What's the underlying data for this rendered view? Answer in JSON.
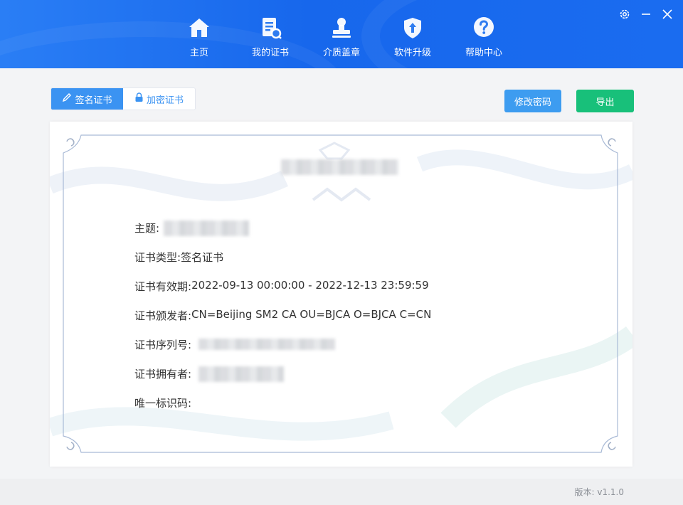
{
  "nav": {
    "items": [
      {
        "label": "主页",
        "icon": "home-icon"
      },
      {
        "label": "我的证书",
        "icon": "certificate-icon"
      },
      {
        "label": "介质盖章",
        "icon": "stamp-icon"
      },
      {
        "label": "软件升级",
        "icon": "upgrade-shield-icon"
      },
      {
        "label": "帮助中心",
        "icon": "help-icon"
      }
    ]
  },
  "window": {
    "controls": [
      "settings-icon",
      "minimize-icon",
      "close-icon"
    ]
  },
  "toolbar": {
    "tabs": [
      {
        "label": "签名证书",
        "icon": "pen-icon",
        "active": true
      },
      {
        "label": "加密证书",
        "icon": "lock-icon",
        "active": false
      }
    ],
    "change_password_label": "修改密码",
    "export_label": "导出"
  },
  "certificate": {
    "fields": [
      {
        "label": "主题:",
        "value": ""
      },
      {
        "label": "证书类型:",
        "value": "签名证书"
      },
      {
        "label": "证书有效期:",
        "value": "2022-09-13 00:00:00 - 2022-12-13 23:59:59"
      },
      {
        "label": "证书颁发者:",
        "value": "CN=Beijing SM2 CA OU=BJCA O=BJCA C=CN"
      },
      {
        "label": "证书序列号:",
        "value": ""
      },
      {
        "label": "证书拥有者:",
        "value": ""
      },
      {
        "label": "唯一标识码:",
        "value": ""
      }
    ]
  },
  "footer": {
    "version": "版本: v1.1.0"
  },
  "colors": {
    "header_blue": "#1767ec",
    "tab_active": "#3b93f2",
    "change_password": "#3d9cf0",
    "export": "#18c07a"
  }
}
